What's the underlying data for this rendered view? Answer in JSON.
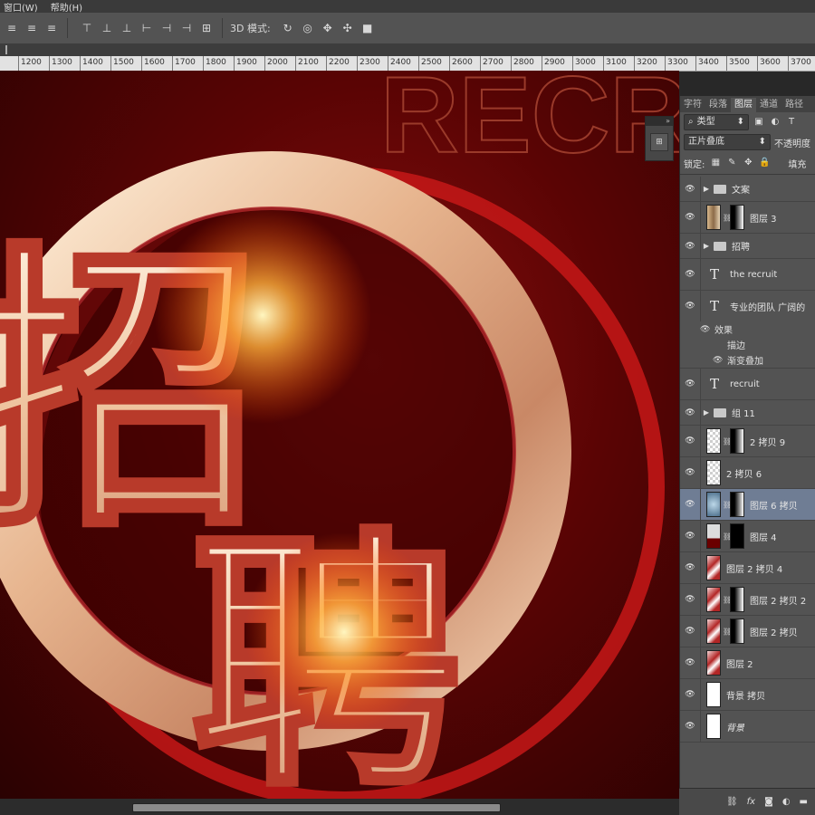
{
  "menubar": {
    "items": [
      "窗口(W)",
      "帮助(H)"
    ]
  },
  "options": {
    "mode_label": "3D 模式:"
  },
  "ruler": {
    "ticks": [
      "1200",
      "1300",
      "1400",
      "1500",
      "1600",
      "1700",
      "1800",
      "1900",
      "2000",
      "2100",
      "2200",
      "2300",
      "2400",
      "2500",
      "2600",
      "2700",
      "2800",
      "2900",
      "3000",
      "3100",
      "3200",
      "3300",
      "3400",
      "3500",
      "3600",
      "3700"
    ]
  },
  "panel": {
    "tabs": [
      "字符",
      "段落",
      "图层",
      "通道",
      "路径"
    ],
    "active_tab": "图层",
    "filter_kind": "类型",
    "blend_mode": "正片叠底",
    "opacity_label": "不透明度",
    "lock_label": "锁定:",
    "fill_label": "填充"
  },
  "layers": [
    {
      "name": "文案",
      "kind": "group"
    },
    {
      "name": "图层 3",
      "kind": "masked",
      "thumb": "gold"
    },
    {
      "name": "招聘",
      "kind": "group"
    },
    {
      "name": "the recruit",
      "kind": "text"
    },
    {
      "name": "专业的团队 广阔的",
      "kind": "text"
    },
    {
      "name": "效果",
      "kind": "fx-header"
    },
    {
      "name": "描边",
      "kind": "fx"
    },
    {
      "name": "渐变叠加",
      "kind": "fx"
    },
    {
      "name": "recruit",
      "kind": "text"
    },
    {
      "name": "组 11",
      "kind": "group"
    },
    {
      "name": "2 拷贝 9",
      "kind": "masked",
      "thumb": "check"
    },
    {
      "name": "2 拷贝 6",
      "kind": "plain",
      "thumb": "check"
    },
    {
      "name": "图层 6 拷贝",
      "kind": "masked",
      "thumb": "blue",
      "selected": true
    },
    {
      "name": "图层 4",
      "kind": "masked",
      "thumb": "dark"
    },
    {
      "name": "图层 2 拷贝 4",
      "kind": "plain",
      "thumb": "red"
    },
    {
      "name": "图层 2 拷贝 2",
      "kind": "masked",
      "thumb": "red"
    },
    {
      "name": "图层 2 拷贝",
      "kind": "masked",
      "thumb": "red"
    },
    {
      "name": "图层 2",
      "kind": "plain",
      "thumb": "red"
    },
    {
      "name": "背景 拷贝",
      "kind": "plain",
      "thumb": "white"
    },
    {
      "name": "背景",
      "kind": "plain",
      "thumb": "white",
      "italic": true
    }
  ],
  "canvas_text": {
    "bg_word": "RECRUIT",
    "main_chars": [
      "招",
      "聘"
    ]
  },
  "icons": {
    "eye": "eye-icon",
    "folder": "folder-icon",
    "text": "text-layer-icon",
    "chain": "link-icon",
    "lock": "lock-icon"
  },
  "colors": {
    "panel_bg": "#535353",
    "selected": "#6f7d94",
    "canvas_red": "#8a0e0e"
  }
}
